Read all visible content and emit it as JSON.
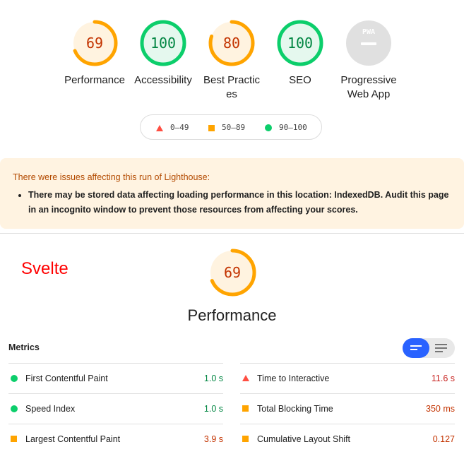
{
  "colors": {
    "fail": "#ff4e42",
    "average": "#ffa400",
    "pass": "#0cce6b",
    "toggle_active": "#2962ff"
  },
  "categories": [
    {
      "label": "Performance",
      "score": "69",
      "rating": "average"
    },
    {
      "label": "Accessibility",
      "score": "100",
      "rating": "pass"
    },
    {
      "label": "Best Practices",
      "score": "80",
      "rating": "average"
    },
    {
      "label": "SEO",
      "score": "100",
      "rating": "pass"
    },
    {
      "label": "Progressive Web App",
      "score": "PWA",
      "rating": "na"
    }
  ],
  "legend": [
    {
      "range": "0–49",
      "icon": "triangle-icon"
    },
    {
      "range": "50–89",
      "icon": "square-icon"
    },
    {
      "range": "90–100",
      "icon": "circle-icon"
    }
  ],
  "warning": {
    "title": "There were issues affecting this run of Lighthouse:",
    "items": [
      "There may be stored data affecting loading performance in this location: IndexedDB. Audit this page in an incognito window to prevent those resources from affecting your scores."
    ]
  },
  "section": {
    "annotation": "Svelte",
    "score": "69",
    "title": "Performance"
  },
  "metrics": {
    "heading": "Metrics",
    "left": [
      {
        "name": "First Contentful Paint",
        "value": "1.0 s",
        "rating": "pass"
      },
      {
        "name": "Speed Index",
        "value": "1.0 s",
        "rating": "pass"
      },
      {
        "name": "Largest Contentful Paint",
        "value": "3.9 s",
        "rating": "average"
      }
    ],
    "right": [
      {
        "name": "Time to Interactive",
        "value": "11.6 s",
        "rating": "fail"
      },
      {
        "name": "Total Blocking Time",
        "value": "350 ms",
        "rating": "average"
      },
      {
        "name": "Cumulative Layout Shift",
        "value": "0.127",
        "rating": "average"
      }
    ]
  }
}
